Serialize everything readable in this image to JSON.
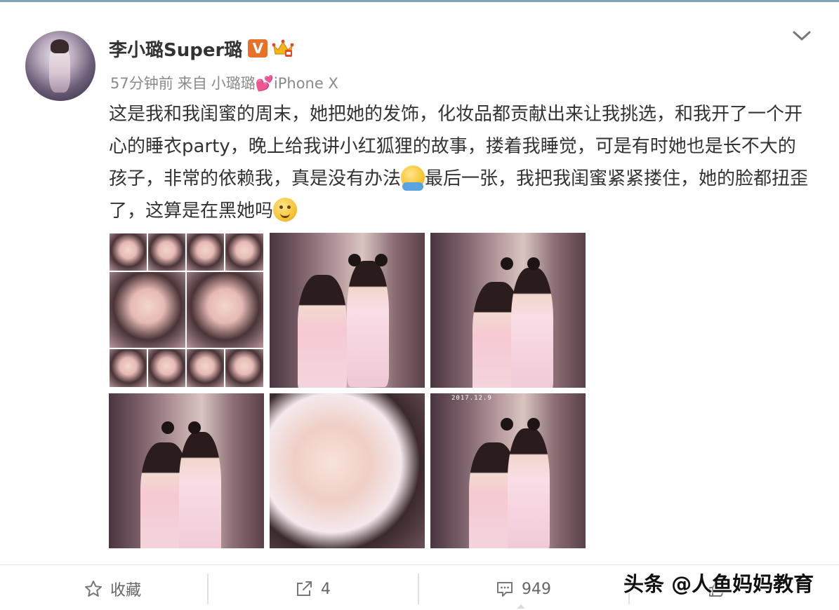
{
  "post": {
    "username": "李小璐Super璐",
    "verified_badge": "V",
    "timestamp": "57分钟前",
    "source_prefix": "来自",
    "source": "小璐璐💕iPhone X",
    "text_part1": "这是我和我闺蜜的周末，她把她的发饰，化妆品都贡献出来让我挑选，和我开了一个开心的睡衣party，晚上给我讲小红狐狸的故事，搂着我睡觉，可是有时她也是长不大的孩子，非常的依赖我，真是没有办法",
    "text_part2": "最后一张，我把我闺蜜紧紧搂住，她的脸都扭歪了，这算是在黑她吗",
    "photo_count": 6,
    "photo_datestamp": "2017.12.9"
  },
  "actions": {
    "favorite_label": "收藏",
    "share_count": "4",
    "comment_count": "949"
  },
  "watermark": "头条 @人鱼妈妈教育",
  "icons": {
    "more": "chevron-down-icon",
    "favorite": "star-icon",
    "share": "share-icon",
    "comment": "comment-icon",
    "like": "thumb-up-icon"
  },
  "colors": {
    "vip_badge": "#e8712a",
    "meta_text": "#8a8a8a",
    "body_text": "#333333"
  }
}
